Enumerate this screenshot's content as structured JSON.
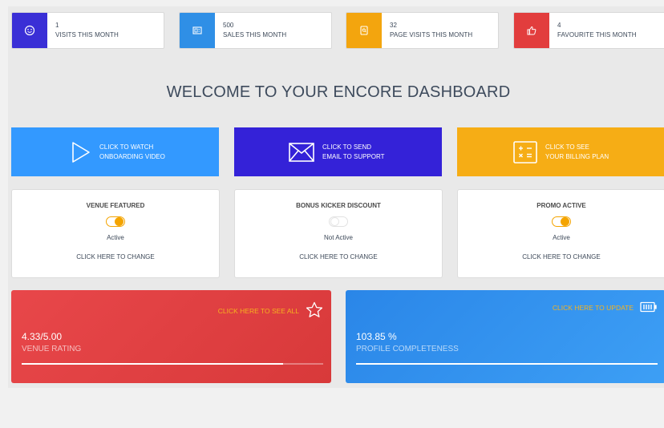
{
  "stats": [
    {
      "value": "1",
      "label": "VISITS THIS MONTH",
      "color": "#3a2fd6",
      "icon": "smile-icon"
    },
    {
      "value": "500",
      "label": "SALES THIS MONTH",
      "color": "#2f8fe6",
      "icon": "calculator-screen-icon"
    },
    {
      "value": "32",
      "label": "PAGE VISITS THIS MONTH",
      "color": "#f3a50e",
      "icon": "page-search-icon"
    },
    {
      "value": "4",
      "label": "FAVOURITE THIS MONTH",
      "color": "#e23d3d",
      "icon": "thumbs-up-icon"
    }
  ],
  "welcome_title": "WELCOME TO YOUR ENCORE DASHBOARD",
  "actions": [
    {
      "line1": "CLICK TO WATCH",
      "line2": "ONBOARDING VIDEO",
      "color": "#3399ff",
      "icon": "play-icon"
    },
    {
      "line1": "CLICK TO SEND",
      "line2": "EMAIL TO SUPPORT",
      "color": "#3422d8",
      "icon": "envelope-icon"
    },
    {
      "line1": "CLICK TO SEE",
      "line2": "YOUR BILLING PLAN",
      "color": "#f6ad15",
      "icon": "calculator-icon"
    }
  ],
  "toggles": [
    {
      "title": "VENUE FEATURED",
      "state": "Active",
      "on": true,
      "change": "CLICK HERE TO CHANGE"
    },
    {
      "title": "BONUS KICKER DISCOUNT",
      "state": "Not Active",
      "on": false,
      "change": "CLICK HERE TO CHANGE"
    },
    {
      "title": "PROMO ACTIVE",
      "state": "Active",
      "on": true,
      "change": "CLICK HERE TO CHANGE"
    }
  ],
  "metrics": [
    {
      "link": "CLICK HERE TO SEE ALL",
      "value": "4.33/5.00",
      "label": "VENUE RATING",
      "progress": 0.866,
      "color": "#e24447",
      "icon": "star-icon"
    },
    {
      "link": "CLICK HERE TO UPDATE",
      "value": "103.85 %",
      "label": "PROFILE COMPLETENESS",
      "progress": 1.0,
      "color": "#2f8be6",
      "icon": "battery-icon"
    }
  ]
}
